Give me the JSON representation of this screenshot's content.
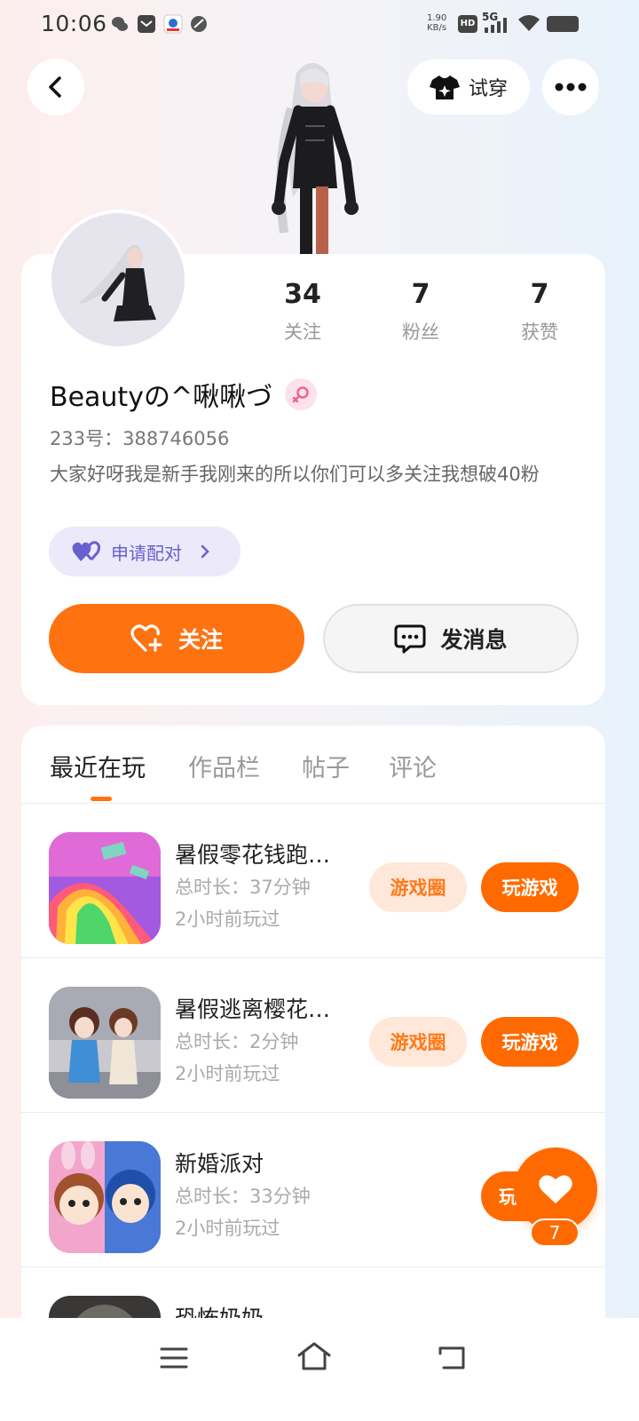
{
  "status_bar": {
    "time": "10:06",
    "net_speed_value": "1.90",
    "net_speed_unit": "KB/s",
    "hd_label": "HD",
    "network_label": "5G"
  },
  "header": {
    "try_on_label": "试穿"
  },
  "profile": {
    "stats": [
      {
        "value": "34",
        "label": "关注"
      },
      {
        "value": "7",
        "label": "粉丝"
      },
      {
        "value": "7",
        "label": "获赞"
      }
    ],
    "username": "Beautyの^啾啾づ",
    "uid_label": "233号：",
    "uid_value": "388746056",
    "bio": "大家好呀我是新手我刚来的所以你们可以多关注我想破40粉",
    "pair_label": "申请配对",
    "follow_label": "关注",
    "message_label": "发消息"
  },
  "tabs": [
    {
      "label": "最近在玩",
      "active": true
    },
    {
      "label": "作品栏",
      "active": false
    },
    {
      "label": "帖子",
      "active": false
    },
    {
      "label": "评论",
      "active": false
    }
  ],
  "games": [
    {
      "title": "暑假零花钱跑…",
      "duration": "总时长：37分钟",
      "last_played": "2小时前玩过",
      "circle_label": "游戏圈",
      "play_label": "玩游戏"
    },
    {
      "title": "暑假逃离樱花…",
      "duration": "总时长：2分钟",
      "last_played": "2小时前玩过",
      "circle_label": "游戏圈",
      "play_label": "玩游戏"
    },
    {
      "title": "新婚派对",
      "duration": "总时长：33分钟",
      "last_played": "2小时前玩过",
      "play_label": "玩"
    },
    {
      "title": "恐怖奶奶"
    }
  ],
  "like_fab": {
    "count": "7"
  },
  "colors": {
    "accent": "#ff6a00",
    "pair": "#6a5fd0",
    "gender": "#f06292"
  }
}
